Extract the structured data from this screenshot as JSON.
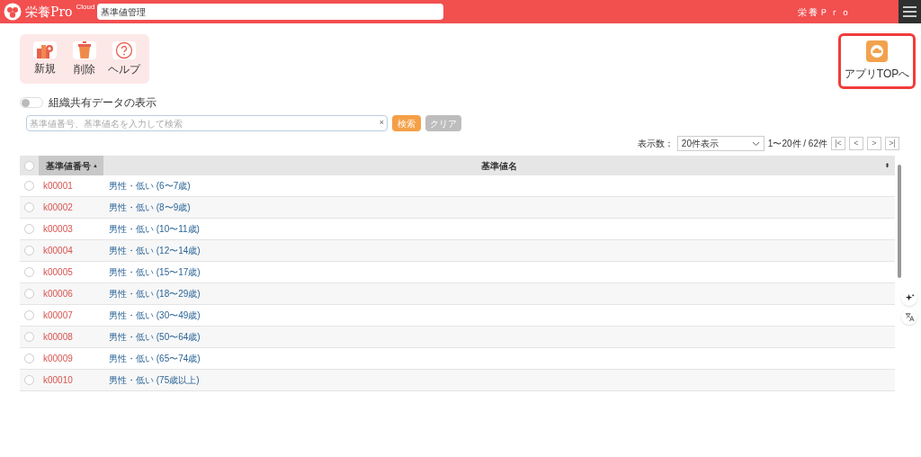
{
  "header": {
    "logo": "栄養Pro",
    "logo_sup": "Cloud",
    "page_field": "基準値管理",
    "user": "栄養Ｐｒｏ"
  },
  "toolbar": [
    {
      "kind": "new",
      "label": "新規"
    },
    {
      "kind": "delete",
      "label": "削除"
    },
    {
      "kind": "help",
      "label": "ヘルプ"
    }
  ],
  "app_top": {
    "label": "アプリTOPへ"
  },
  "share_toggle": {
    "label": "組織共有データの表示",
    "on": false
  },
  "search": {
    "placeholder": "基準値番号、基準値名を入力して検索",
    "clear_icon": "×",
    "search_button": "検索",
    "clear_button": "クリア"
  },
  "pager": {
    "label": "表示数：",
    "page_size": "20件表示",
    "range": "1〜20件 / 62件",
    "buttons": [
      "|<",
      "<",
      ">",
      ">|"
    ]
  },
  "table": {
    "all_selected": false,
    "columns": [
      {
        "label": "基準値番号",
        "sort": "▲",
        "sorted": true
      },
      {
        "label": "基準値名",
        "sort": "⬍",
        "sorted": false
      }
    ],
    "rows": [
      {
        "selected": false,
        "code": "k00001",
        "name": "男性・低い (6〜7歳)"
      },
      {
        "selected": false,
        "code": "k00002",
        "name": "男性・低い (8〜9歳)"
      },
      {
        "selected": false,
        "code": "k00003",
        "name": "男性・低い (10〜11歳)"
      },
      {
        "selected": false,
        "code": "k00004",
        "name": "男性・低い (12〜14歳)"
      },
      {
        "selected": false,
        "code": "k00005",
        "name": "男性・低い (15〜17歳)"
      },
      {
        "selected": false,
        "code": "k00006",
        "name": "男性・低い (18〜29歳)"
      },
      {
        "selected": false,
        "code": "k00007",
        "name": "男性・低い (30〜49歳)"
      },
      {
        "selected": false,
        "code": "k00008",
        "name": "男性・低い (50〜64歳)"
      },
      {
        "selected": false,
        "code": "k00009",
        "name": "男性・低い (65〜74歳)"
      },
      {
        "selected": false,
        "code": "k00010",
        "name": "男性・低い (75歳以上)"
      }
    ]
  }
}
